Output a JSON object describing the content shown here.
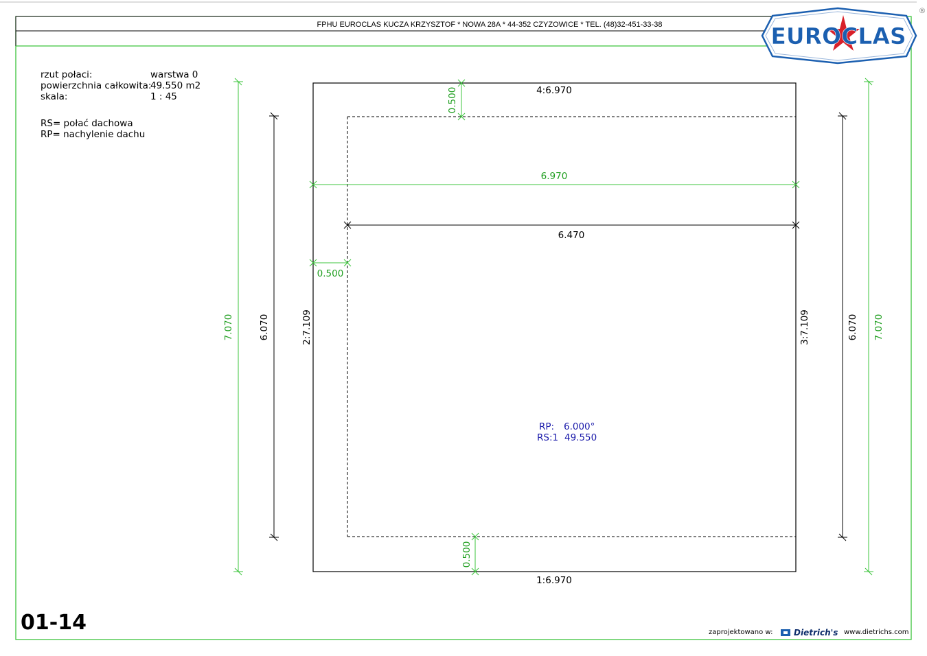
{
  "header": {
    "company_line": "FPHU EUROCLAS KUCZA KRZYSZTOF * NOWA 28A * 44-352 CZYZOWICE * TEL. (48)32-451-33-38",
    "logo_text": "EUROCLAS",
    "registered_mark": "®"
  },
  "info": {
    "label_rzut": "rzut połaci:",
    "value_rzut": "warstwa 0",
    "label_area": "powierzchnia całkowita:",
    "value_area": "49.550 m2",
    "label_scale": "skala:",
    "value_scale": "1 : 45",
    "legend_rs": "RS= połać dachowa",
    "legend_rp": "RP= nachylenie dachu"
  },
  "dimensions": {
    "top_edge": "4:6.970",
    "bottom_edge": "1:6.970",
    "left_edge": "2:7.109",
    "right_edge": "3:7.109",
    "width_outer": "6.970",
    "width_inner": "6.470",
    "height_outer_left": "7.070",
    "height_inner_left": "6.070",
    "height_outer_right": "7.070",
    "height_inner_right": "6.070",
    "overhang_top": "0.500",
    "overhang_left": "0.500",
    "overhang_bottom": "0.500"
  },
  "roof": {
    "rp_label": "RP:",
    "rp_value": "6.000°",
    "rs_label": "RS:1",
    "rs_value": "49.550"
  },
  "sheet_number": "01-14",
  "footer": {
    "designed_in": "zaprojektowano w:",
    "brand": "Dietrich's",
    "url": "www.dietrichs.com"
  },
  "colors": {
    "frame": "#3cc43c",
    "dimension_green": "#1e9e1e",
    "roof_text": "#1a1aaa",
    "logo_blue": "#1b5fb0",
    "logo_red": "#d8202a"
  }
}
